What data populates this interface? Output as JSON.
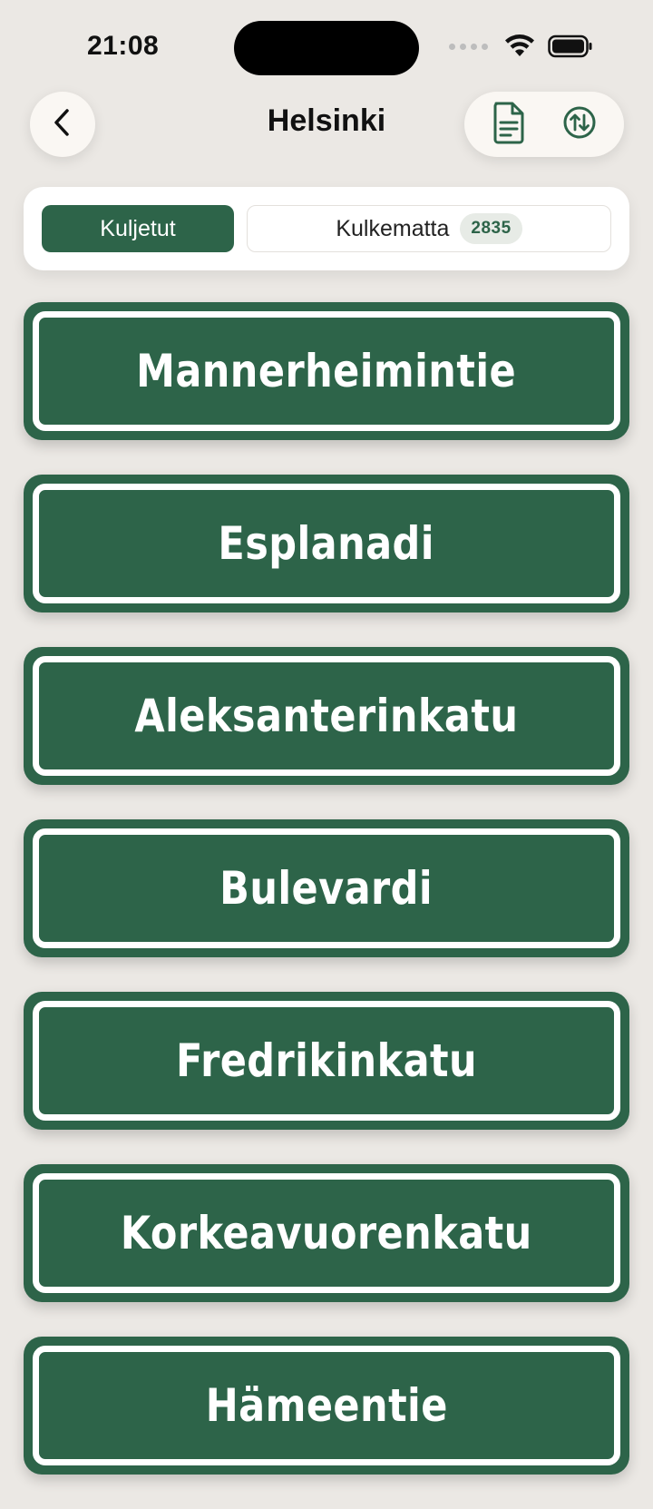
{
  "status_bar": {
    "time": "21:08"
  },
  "header": {
    "title": "Helsinki",
    "back_icon": "chevron-left-icon",
    "actions": [
      {
        "icon": "document-icon"
      },
      {
        "icon": "sort-arrows-icon"
      }
    ]
  },
  "segments": {
    "active_label": "Kuljetut",
    "inactive_label": "Kulkematta",
    "inactive_count": "2835"
  },
  "colors": {
    "accent": "#2d6449",
    "background": "#ebe8e4",
    "sign_border": "#ffffff"
  },
  "streets": [
    {
      "name": "Mannerheimintie"
    },
    {
      "name": "Esplanadi"
    },
    {
      "name": "Aleksanterinkatu"
    },
    {
      "name": "Bulevardi"
    },
    {
      "name": "Fredrikinkatu"
    },
    {
      "name": "Korkeavuorenkatu"
    },
    {
      "name": "Hämeentie"
    }
  ]
}
